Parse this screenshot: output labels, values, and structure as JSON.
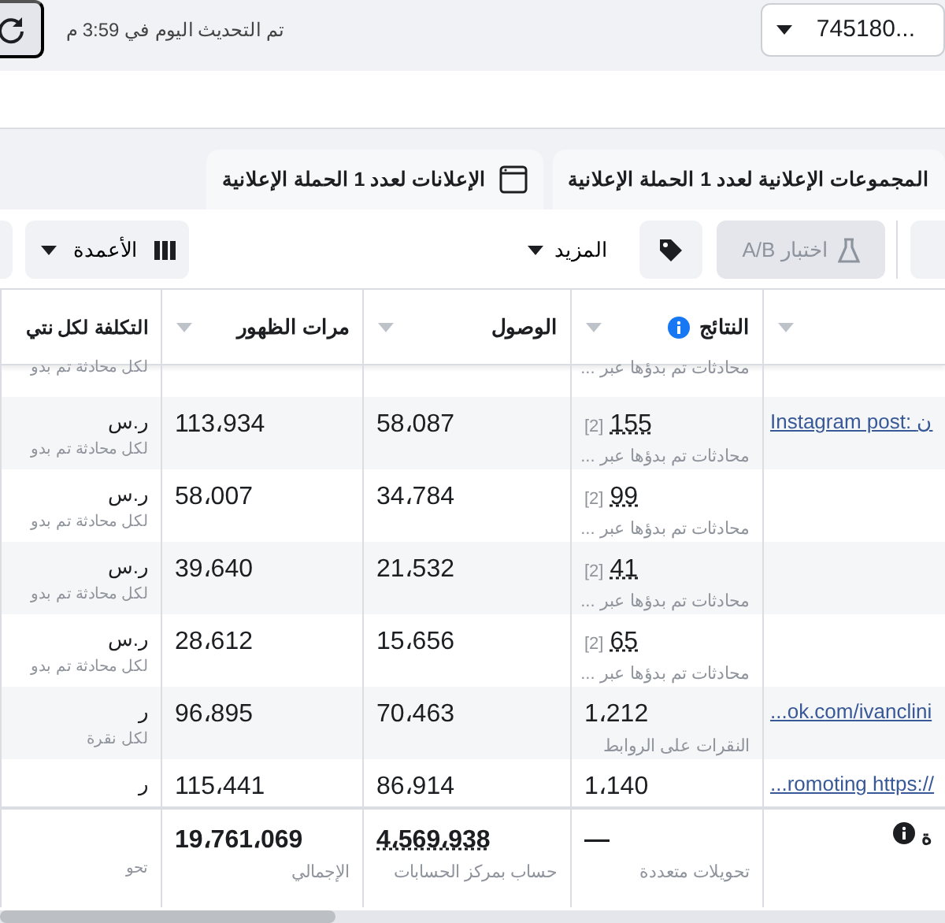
{
  "top_bar": {
    "updated_text": "تم التحديث اليوم في 3:59 م",
    "account": "...745180"
  },
  "tabs": [
    {
      "label": "المجموعات الإعلانية لعدد **1** الحملة الإعلانية",
      "selected": false,
      "kind": "plain"
    },
    {
      "label": "الإعلانات لعدد **1** الحملة الإعلانية",
      "selected": false,
      "kind": "window"
    }
  ],
  "toolbar": {
    "ab_test": {
      "label": "اختبار A/B",
      "disabled": true
    },
    "more": "المزيد",
    "columns": "الأعمدة"
  },
  "table": {
    "columns": [
      {
        "label": "النتائج",
        "info": true
      },
      {
        "label": "الوصول"
      },
      {
        "label": "مرات الظهور"
      },
      {
        "label": "التكلفة لكل نتي"
      }
    ],
    "top_partial": {
      "result_sub": "محادثات تم بدؤها عبر ...",
      "cost_sub": "لكل محادثة تم بدو"
    },
    "rows": [
      {
        "name": "Instagram post: ن",
        "result": "155",
        "note": "[2]",
        "result_sub": "محادثات تم بدؤها عبر ...",
        "reach": "58،087",
        "impressions": "113،934",
        "cost": "ر.س",
        "cost_sub": "لكل محادثة تم بدو"
      },
      {
        "name": "",
        "result": "99",
        "note": "[2]",
        "result_sub": "محادثات تم بدؤها عبر ...",
        "reach": "34،784",
        "impressions": "58،007",
        "cost": "ر.س",
        "cost_sub": "لكل محادثة تم بدو"
      },
      {
        "name": "",
        "result": "41",
        "note": "[2]",
        "result_sub": "محادثات تم بدؤها عبر ...",
        "reach": "21،532",
        "impressions": "39،640",
        "cost": "ر.س",
        "cost_sub": "لكل محادثة تم بدو"
      },
      {
        "name": "",
        "result": "65",
        "note": "[2]",
        "result_sub": "محادثات تم بدؤها عبر ...",
        "reach": "15،656",
        "impressions": "28،612",
        "cost": "ر.س",
        "cost_sub": "لكل محادثة تم بدو"
      },
      {
        "name": "...ok.com/ivanclini",
        "result": "1،212",
        "note": "",
        "result_sub": "النقرات على الروابط",
        "reach": "70،463",
        "impressions": "96،895",
        "cost": "ر",
        "cost_sub": "لكل نقرة"
      },
      {
        "name": "...romoting https://",
        "result": "1،140",
        "note": "",
        "result_sub": "",
        "reach": "86،914",
        "impressions": "115،441",
        "cost": "ر",
        "cost_sub": ""
      }
    ],
    "footer": {
      "name": "ة",
      "result": "—",
      "result_sub": "تحويلات متعددة",
      "reach": "4،569،938",
      "reach_sub": "حساب بمركز الحسابات",
      "impressions": "19،761،069",
      "impressions_sub": "الإجمالي",
      "cost_sub": "تحو"
    }
  }
}
